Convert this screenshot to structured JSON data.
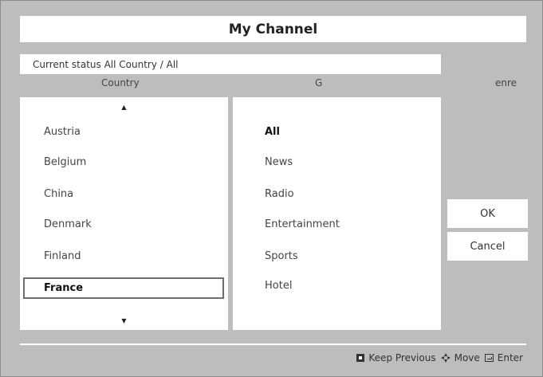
{
  "window": {
    "title": "My Channel"
  },
  "status": {
    "text": "Current status All Country / All"
  },
  "columns": {
    "country": "Country",
    "genre_first": "G",
    "genre_rest": "enre"
  },
  "country_list": {
    "items": [
      "Austria",
      "Belgium",
      "China",
      "Denmark",
      "Finland"
    ],
    "selected": "France"
  },
  "genre_list": {
    "active": "All",
    "items": [
      "News",
      "Radio",
      "Entertainment",
      "Sports",
      "Hotel"
    ]
  },
  "buttons": {
    "ok": "OK",
    "cancel": "Cancel"
  },
  "footer": {
    "keep_previous": "Keep Previous",
    "move": "Move",
    "enter": "Enter"
  },
  "icons": {
    "scroll_up": "arrow-up-icon",
    "scroll_down": "arrow-down-icon",
    "keep_previous": "square-button-icon",
    "move": "four-way-arrow-icon",
    "enter": "enter-icon"
  },
  "colors": {
    "background": "#bdbdbd",
    "panel": "#ffffff",
    "selection_border": "#6e6e6e"
  }
}
